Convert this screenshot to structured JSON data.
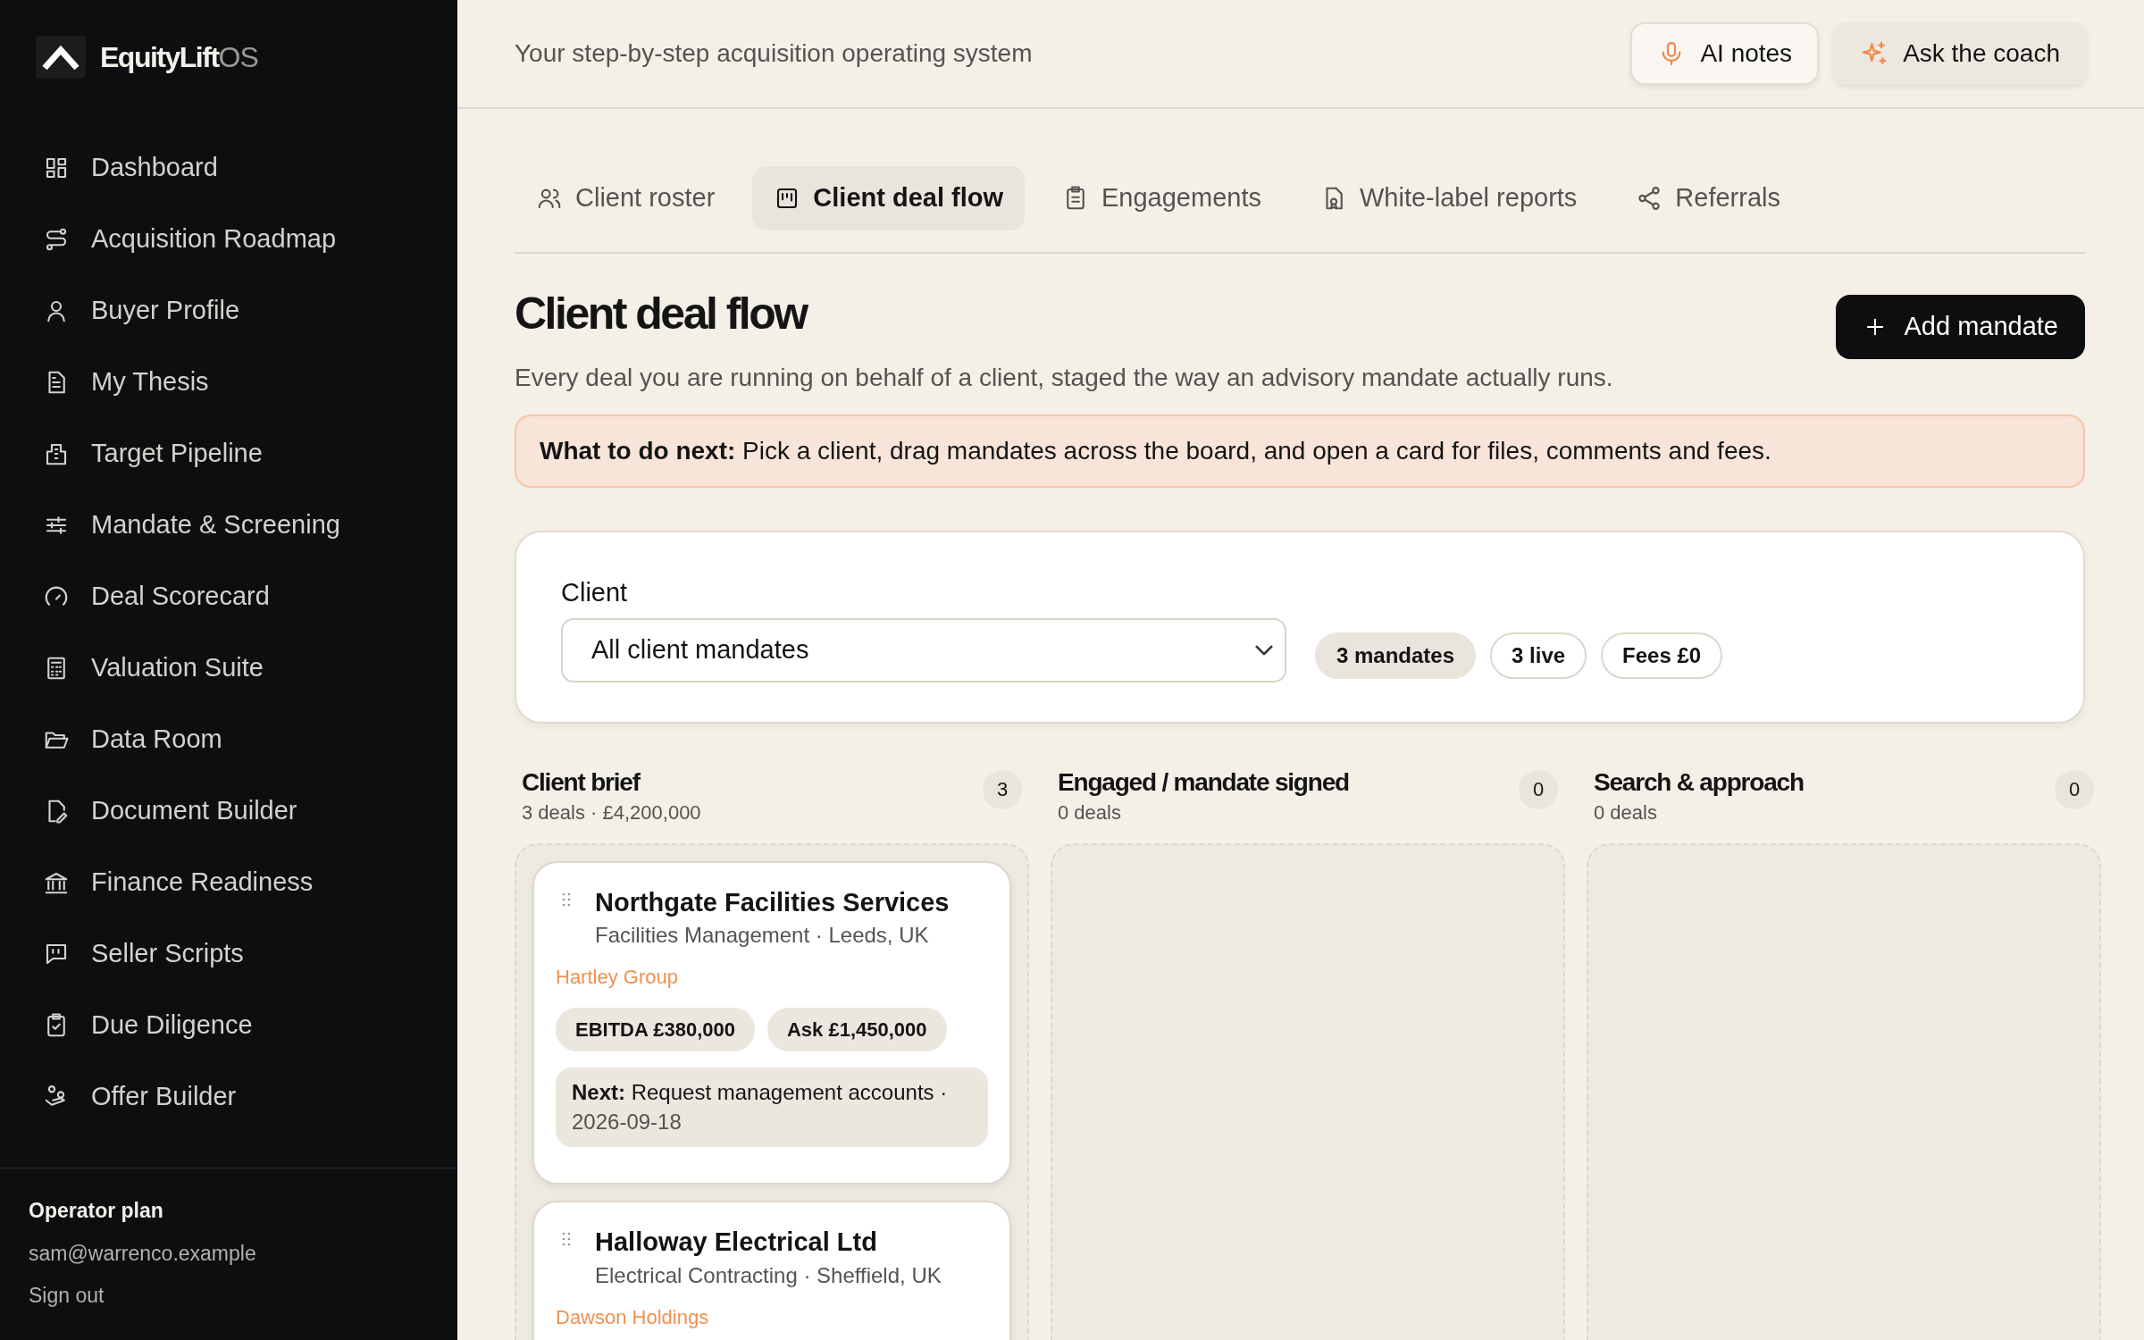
{
  "brand": {
    "name": "EquityLift",
    "suffix": "OS"
  },
  "sidebar": {
    "items": [
      {
        "label": "Dashboard"
      },
      {
        "label": "Acquisition Roadmap"
      },
      {
        "label": "Buyer Profile"
      },
      {
        "label": "My Thesis"
      },
      {
        "label": "Target Pipeline"
      },
      {
        "label": "Mandate & Screening"
      },
      {
        "label": "Deal Scorecard"
      },
      {
        "label": "Valuation Suite"
      },
      {
        "label": "Data Room"
      },
      {
        "label": "Document Builder"
      },
      {
        "label": "Finance Readiness"
      },
      {
        "label": "Seller Scripts"
      },
      {
        "label": "Due Diligence"
      },
      {
        "label": "Offer Builder"
      }
    ],
    "footer": {
      "plan": "Operator plan",
      "email": "sam@warrenco.example",
      "sign_out": "Sign out"
    }
  },
  "topbar": {
    "tagline": "Your step-by-step acquisition operating system",
    "buttons": [
      {
        "label": "AI notes",
        "kind": "light"
      },
      {
        "label": "Ask the coach",
        "kind": "tinted"
      }
    ]
  },
  "tabs": [
    {
      "label": "Client roster",
      "selected": false
    },
    {
      "label": "Client deal flow",
      "selected": true
    },
    {
      "label": "Engagements",
      "selected": false
    },
    {
      "label": "White-label reports",
      "selected": false
    },
    {
      "label": "Referrals",
      "selected": false
    }
  ],
  "page": {
    "title": "Client deal flow",
    "subtitle": "Every deal you are running on behalf of a client, staged the way an advisory mandate actually runs.",
    "add_button": "Add mandate",
    "hint": "**What to do next:** Pick a client, drag mandates across the board, and open a card for files, comments and fees."
  },
  "filter": {
    "label": "Client",
    "value": "All client mandates",
    "chips": [
      {
        "label": "3 mandates",
        "kind": "filled"
      },
      {
        "label": "3 live",
        "kind": "outline"
      },
      {
        "label": "Fees £0",
        "kind": "outline"
      }
    ]
  },
  "columns": [
    {
      "title": "Client brief",
      "summary": "3 deals · £4,200,000",
      "count": "3",
      "cards": [
        {
          "name": "Northgate Facilities Services",
          "meta": "Facilities Management · Leeds, UK",
          "client": "Hartley Group",
          "tags": [
            "EBITDA £380,000",
            "Ask £1,450,000"
          ],
          "next": {
            "label": "Next:",
            "text": "Request management accounts ·",
            "date": "2026-09-18"
          }
        },
        {
          "name": "Halloway Electrical Ltd",
          "meta": "Electrical Contracting · Sheffield, UK",
          "client": "Dawson Holdings"
        }
      ]
    },
    {
      "title": "Engaged / mandate signed",
      "summary": "0 deals",
      "count": "0"
    },
    {
      "title": "Search & approach",
      "summary": "0 deals",
      "count": "0"
    }
  ]
}
